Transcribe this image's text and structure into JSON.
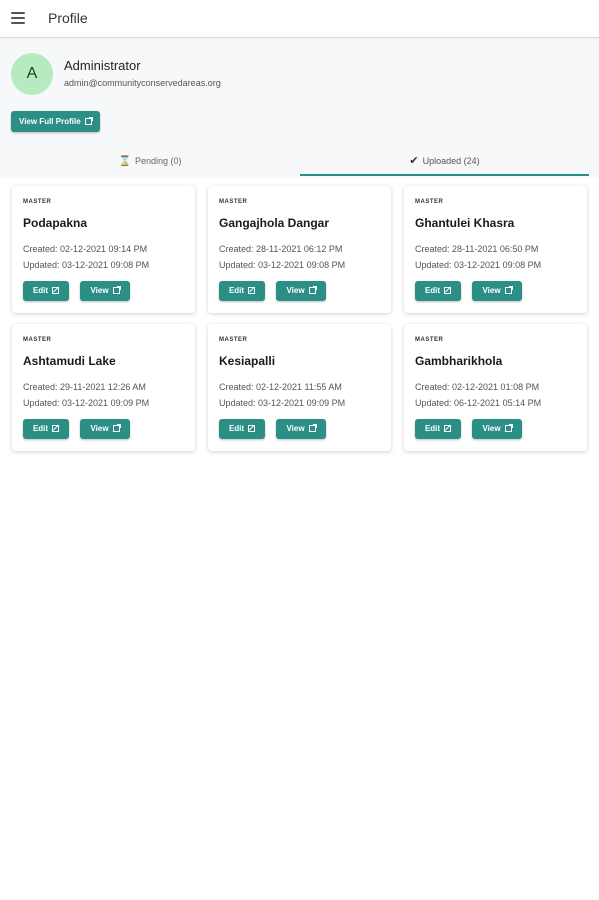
{
  "appbar": {
    "title": "Profile",
    "menu_icon": "hamburger-menu-icon"
  },
  "profile": {
    "avatar_letter": "A",
    "name": "Administrator",
    "email": "admin@communityconservedareas.org",
    "full_profile_label": "View Full Profile",
    "avatar_color": "#b6ebc0"
  },
  "tabs": {
    "pending": {
      "icon": "⌛",
      "label": "Pending (0)"
    },
    "uploaded": {
      "icon": "✔",
      "label": "Uploaded (24)"
    }
  },
  "accent_color": "#2b8f86",
  "cards": [
    {
      "category": "MASTER",
      "title": "Podapakna",
      "created": "Created: 02-12-2021 09:14 PM",
      "updated": "Updated: 03-12-2021 09:08 PM",
      "edit_label": "Edit",
      "view_label": "View"
    },
    {
      "category": "MASTER",
      "title": "Gangajhola Dangar",
      "created": "Created: 28-11-2021 06:12 PM",
      "updated": "Updated: 03-12-2021 09:08 PM",
      "edit_label": "Edit",
      "view_label": "View"
    },
    {
      "category": "MASTER",
      "title": "Ghantulei Khasra",
      "created": "Created: 28-11-2021 06:50 PM",
      "updated": "Updated: 03-12-2021 09:08 PM",
      "edit_label": "Edit",
      "view_label": "View"
    },
    {
      "category": "MASTER",
      "title": "Ashtamudi Lake",
      "created": "Created: 29-11-2021 12:26 AM",
      "updated": "Updated: 03-12-2021 09:09 PM",
      "edit_label": "Edit",
      "view_label": "View"
    },
    {
      "category": "MASTER",
      "title": "Kesiapalli",
      "created": "Created: 02-12-2021 11:55 AM",
      "updated": "Updated: 03-12-2021 09:09 PM",
      "edit_label": "Edit",
      "view_label": "View"
    },
    {
      "category": "MASTER",
      "title": "Gambharikhola",
      "created": "Created: 02-12-2021 01:08 PM",
      "updated": "Updated: 06-12-2021 05:14 PM",
      "edit_label": "Edit",
      "view_label": "View"
    }
  ]
}
